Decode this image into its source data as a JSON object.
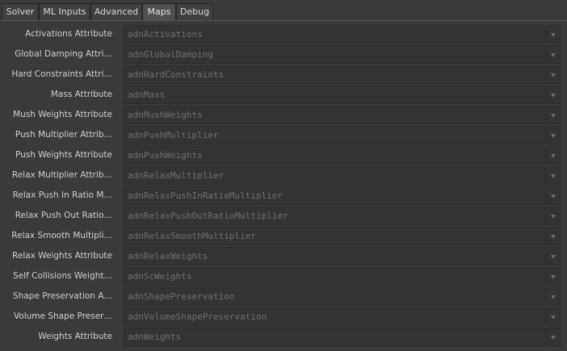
{
  "tabs": [
    {
      "label": "Solver",
      "active": false
    },
    {
      "label": "ML Inputs",
      "active": false
    },
    {
      "label": "Advanced",
      "active": false
    },
    {
      "label": "Maps",
      "active": true
    },
    {
      "label": "Debug",
      "active": false
    }
  ],
  "rows": [
    {
      "label": "Activations Attribute",
      "value": "adnActivations"
    },
    {
      "label": "Global Damping Attri…",
      "value": "adnGlobalDamping"
    },
    {
      "label": "Hard Constraints Attri…",
      "value": "adnHardConstraints"
    },
    {
      "label": "Mass Attribute",
      "value": "adnMass"
    },
    {
      "label": "Mush Weights Attribute",
      "value": "adnMushWeights"
    },
    {
      "label": "Push Multiplier Attrib…",
      "value": "adnPushMultiplier"
    },
    {
      "label": "Push Weights Attribute",
      "value": "adnPushWeights"
    },
    {
      "label": "Relax Multiplier Attrib…",
      "value": "adnRelaxMultiplier"
    },
    {
      "label": "Relax Push In Ratio M…",
      "value": "adnRelaxPushInRatioMultiplier"
    },
    {
      "label": "Relax Push Out Ratio…",
      "value": "adnRelaxPushOutRatioMultiplier"
    },
    {
      "label": "Relax Smooth Multipli…",
      "value": "adnRelaxSmoothMultiplier"
    },
    {
      "label": "Relax Weights Attribute",
      "value": "adnRelaxWeights"
    },
    {
      "label": "Self Collisions Weight…",
      "value": "adnScWeights"
    },
    {
      "label": "Shape Preservation A…",
      "value": "adnShapePreservation"
    },
    {
      "label": "Volume Shape Preser…",
      "value": "adnVolumeShapePreservation"
    },
    {
      "label": "Weights Attribute",
      "value": "adnWeights"
    }
  ],
  "icons": {
    "dropdown": "chevron-down-icon"
  },
  "colors": {
    "background": "#3a3a3a",
    "field_background": "#333333",
    "field_text": "#707070",
    "label_text": "#d0d0d0",
    "active_tab": "#4f4f4f"
  }
}
